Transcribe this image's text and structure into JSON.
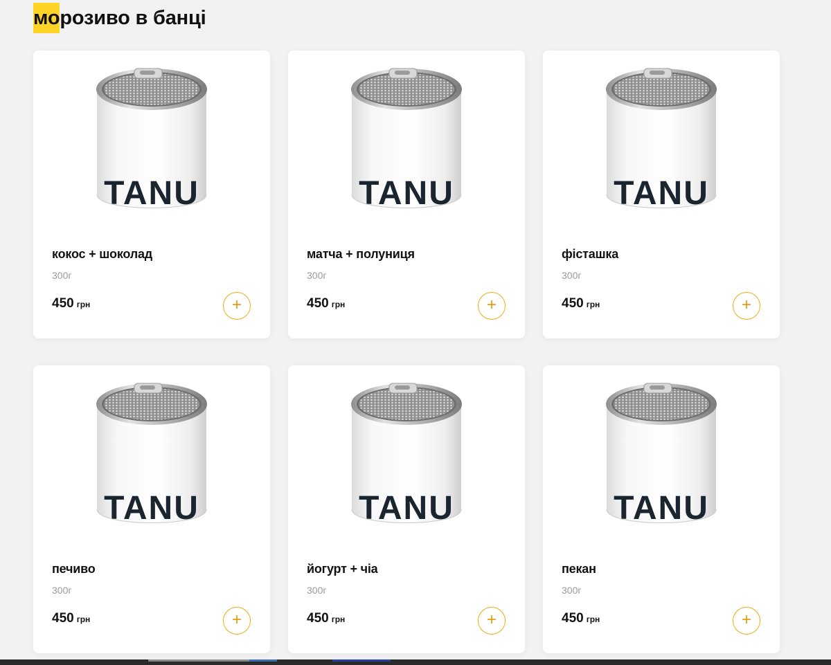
{
  "section": {
    "title_highlight": "мо",
    "title_rest": "розиво в банці"
  },
  "can": {
    "brand_text": "TANU"
  },
  "colors": {
    "accent": "#f2a818",
    "title_highlight": "#ffd426"
  },
  "products": [
    {
      "name": "кокос + шоколад",
      "weight": "300г",
      "price": "450",
      "currency": "грн",
      "add_icon": "plus-icon"
    },
    {
      "name": "матча + полуниця",
      "weight": "300г",
      "price": "450",
      "currency": "грн",
      "add_icon": "plus-icon"
    },
    {
      "name": "фісташка",
      "weight": "300г",
      "price": "450",
      "currency": "грн",
      "add_icon": "plus-icon"
    },
    {
      "name": "печиво",
      "weight": "300г",
      "price": "450",
      "currency": "грн",
      "add_icon": "plus-icon"
    },
    {
      "name": "йогурт + чіа",
      "weight": "300г",
      "price": "450",
      "currency": "грн",
      "add_icon": "plus-icon"
    },
    {
      "name": "пекан",
      "weight": "300г",
      "price": "450",
      "currency": "грн",
      "add_icon": "plus-icon"
    }
  ]
}
